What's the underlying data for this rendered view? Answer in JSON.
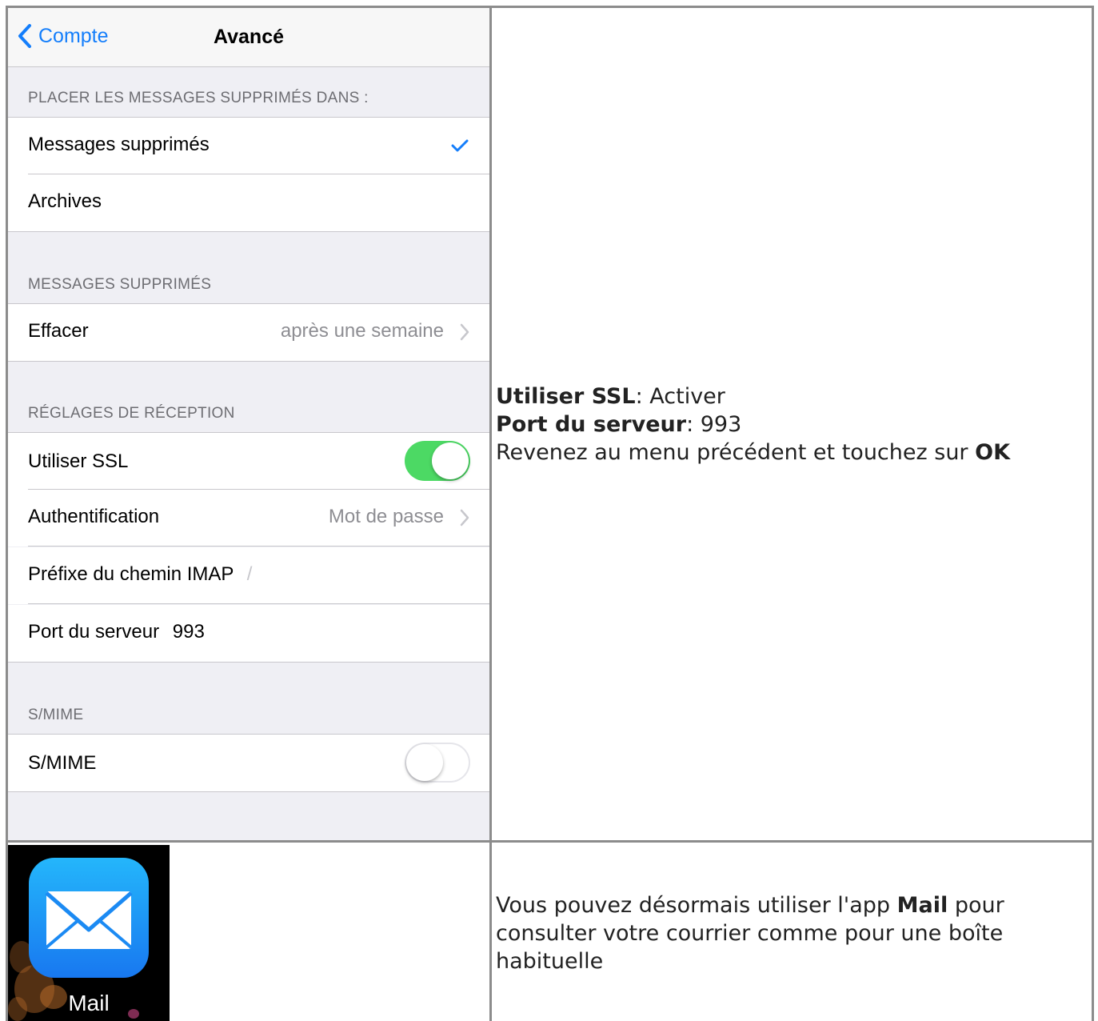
{
  "ios_screen": {
    "back_label": "Compte",
    "title": "Avancé",
    "section_deleted_place": "PLACER LES MESSAGES SUPPRIMÉS DANS :",
    "option_deleted": "Messages supprimés",
    "option_archives": "Archives",
    "section_deleted": "MESSAGES SUPPRIMÉS",
    "erase_label": "Effacer",
    "erase_value": "après une semaine",
    "section_reception": "RÉGLAGES DE RÉCEPTION",
    "ssl_label": "Utiliser SSL",
    "ssl_on": true,
    "auth_label": "Authentification",
    "auth_value": "Mot de passe",
    "imap_prefix_label": "Préfixe du chemin IMAP",
    "imap_prefix_value": "/",
    "port_label": "Port du serveur",
    "port_value": "993",
    "section_smime": "S/MIME",
    "smime_label": "S/MIME",
    "smime_on": false,
    "accent": "#147efb",
    "toggle_on_color": "#4cd964"
  },
  "instructions": {
    "ssl_label": "Utiliser SSL",
    "ssl_sep": ": ",
    "ssl_value": "Activer",
    "port_label": "Port du serveur",
    "port_sep": ": ",
    "port_value": "993",
    "back_text": "Revenez au menu précédent et touchez sur ",
    "back_ok": "OK",
    "final_pre": "Vous pouvez désormais utiliser l'app ",
    "final_app": "Mail",
    "final_line1_post": " pour",
    "final_line2": "consulter votre courrier comme pour une boîte",
    "final_line3": "habituelle"
  },
  "mail_tile": {
    "label": "Mail",
    "icon": "mail-envelope-icon"
  }
}
